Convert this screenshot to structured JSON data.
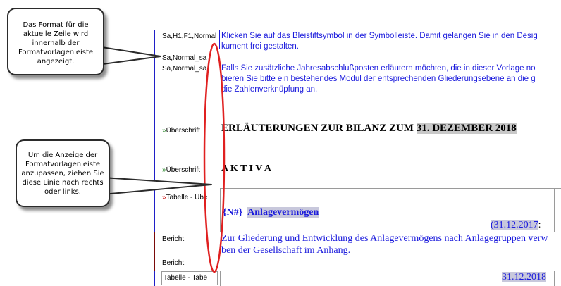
{
  "callouts": {
    "top": "Das Format für die aktuelle Zeile wird innerhalb der Formatvorlagenleiste angezeigt.",
    "bottom": "Um die Anzeige der Formatvorlagenleiste anzupassen, ziehen Sie diese Linie nach rechts oder links."
  },
  "style_bar": {
    "rows": [
      {
        "label": "Sa,H1,F1,Normal"
      },
      {
        "label": "Sa,Normal_sa"
      },
      {
        "label": "Sa,Normal_sa"
      },
      {
        "prefix": "»",
        "label": "Überschrift"
      },
      {
        "prefix": "»",
        "label": "Überschrift"
      },
      {
        "prefix": "»",
        "label": "Tabelle - Übe"
      },
      {
        "label": "Bericht"
      },
      {
        "label": "Bericht"
      },
      {
        "label": "Tabelle - Tabe"
      }
    ]
  },
  "document": {
    "para1_line1": "Klicken Sie auf das Bleistiftsymbol in der Symbolleiste. Damit gelangen Sie in den Desig",
    "para1_line2": "kument frei gestalten.",
    "para2_line1": "Falls Sie zusätzliche Jahresabschlußposten erläutern möchten, die in dieser Vorlage no",
    "para2_line2": "bieren Sie bitte ein bestehendes Modul der entsprechenden Gliederungsebene an die g",
    "para2_line3": "die Zahlenverknüpfung an.",
    "heading1_text": "ERLÄUTERUNGEN ZUR BILANZ ZUM ",
    "heading1_date": "31. DEZEMBER 2018",
    "heading2": "A K T I V A",
    "table": {
      "field_code": "{N#}",
      "title": "Anlagevermögen",
      "col_header": "(31.12.2017",
      "col_header_suffix": ":"
    },
    "bericht_line1": "Zur Gliederung und Entwicklung des Anlagevermögens nach Anlagegruppen verw",
    "bericht_line2": "ben der Gesellschaft im Anhang.",
    "table2_header": "31.12.2018"
  },
  "colors": {
    "style_bar_border": "#1f1fc8",
    "body_text": "#1a1adc",
    "highlight_ellipse": "#e02020",
    "arrow_green": "#2e8b2e",
    "arrow_red": "#cc0000"
  }
}
